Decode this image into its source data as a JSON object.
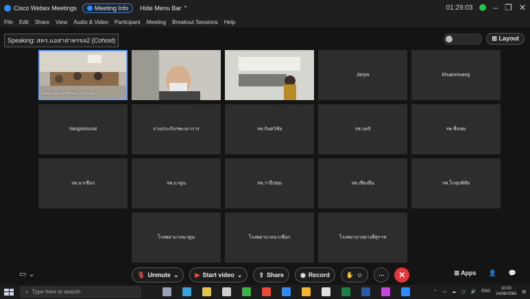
{
  "window": {
    "app_title": "Cisco Webex Meetings",
    "meeting_info_label": "Meeting Info",
    "hide_menu_label": "Hide Menu Bar ⌃",
    "timer": "01:29:03",
    "minimize": "–",
    "restore": "❐",
    "close": "✕"
  },
  "menu": [
    "File",
    "Edit",
    "Share",
    "View",
    "Audio & Video",
    "Participant",
    "Meeting",
    "Breakout Sessions",
    "Help"
  ],
  "speaking_label": "Speaking: สคร.แอสาสาทรจล2 (Cohost)",
  "layout_label": "Layout",
  "tiles": [
    {
      "name": "สคร.แอสาสาทรจล2 (Cohost)",
      "type": "video",
      "active": true
    },
    {
      "name": "",
      "type": "video",
      "active": false
    },
    {
      "name": "",
      "type": "video",
      "active": false
    },
    {
      "name": "Jariya",
      "type": "name",
      "active": false
    },
    {
      "name": "khuanmuang",
      "type": "name",
      "active": false
    },
    {
      "name": "Vangsirisurat",
      "type": "name",
      "active": false
    },
    {
      "name": "งานประกันฯพะเยาการ",
      "type": "name",
      "active": false
    },
    {
      "name": "รพ.กันตวิชัย",
      "type": "name",
      "active": false
    },
    {
      "name": "รพ.กุดจิ",
      "type": "name",
      "active": false
    },
    {
      "name": "รพ.ชื่นชม",
      "type": "name",
      "active": false
    },
    {
      "name": "รพ.นาเชือก",
      "type": "name",
      "active": false
    },
    {
      "name": "รพ.นาดูน",
      "type": "name",
      "active": false
    },
    {
      "name": "รพ.วาปีปทุม",
      "type": "name",
      "active": false
    },
    {
      "name": "รพ.เชียงยืน",
      "type": "name",
      "active": false
    },
    {
      "name": "รพ.โกสุมพิสัย",
      "type": "name",
      "active": false
    },
    {
      "name": "โรงพยาบาลนาดูน",
      "type": "name",
      "active": false
    },
    {
      "name": "โรงพยาบาลนาเชือก",
      "type": "name",
      "active": false
    },
    {
      "name": "โรงพยาบาลยางสีสุราช",
      "type": "name",
      "active": false
    }
  ],
  "controls": {
    "unmute": "Unmute",
    "start_video": "Start video",
    "share": "Share",
    "record": "Record",
    "apps": "Apps"
  },
  "taskbar": {
    "search_placeholder": "Type here to search",
    "lang": "ENG",
    "time": "10:00",
    "date": "24/08/2565"
  }
}
